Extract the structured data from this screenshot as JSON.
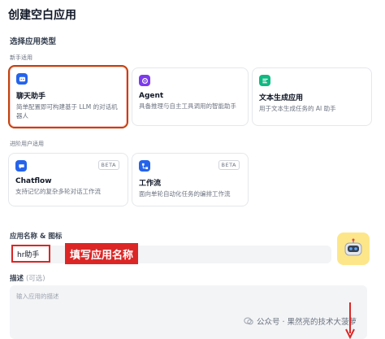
{
  "page": {
    "title": "创建空白应用",
    "app_type_label": "选择应用类型",
    "beginner_group_label": "新手适用",
    "advanced_group_label": "进阶用户适用"
  },
  "cards": {
    "chat_assistant": {
      "name": "聊天助手",
      "desc": "简单配置即可构建基于 LLM 的对话机器人",
      "icon": "chat-bot-icon",
      "color": "#2563eb",
      "selected": true
    },
    "agent": {
      "name": "Agent",
      "desc": "具备推理与自主工具调用的智能助手",
      "icon": "agent-icon",
      "color": "#7c3aed"
    },
    "text_gen": {
      "name": "文本生成应用",
      "desc": "用于文本生成任务的 AI 助手",
      "icon": "text-generation-icon",
      "color": "#10b981"
    },
    "chatflow": {
      "name": "Chatflow",
      "desc": "支持记忆的复杂多轮对话工作流",
      "badge": "BETA",
      "icon": "chatflow-icon",
      "color": "#2563eb"
    },
    "workflow": {
      "name": "工作流",
      "desc": "面向单轮自动化任务的编排工作流",
      "badge": "BETA",
      "icon": "workflow-icon",
      "color": "#2563eb"
    }
  },
  "form": {
    "name_label": "应用名称 & 图标",
    "name_value": "hr助手",
    "annotation": "填写应用名称",
    "description_label": "描述",
    "description_optional": "(可选)",
    "description_placeholder": "输入应用的描述"
  },
  "watermark": "公众号 · 果然亮的技术大菠萝",
  "colors": {
    "annotation_red": "#dc2626",
    "avatar_bg": "#fde68a"
  }
}
